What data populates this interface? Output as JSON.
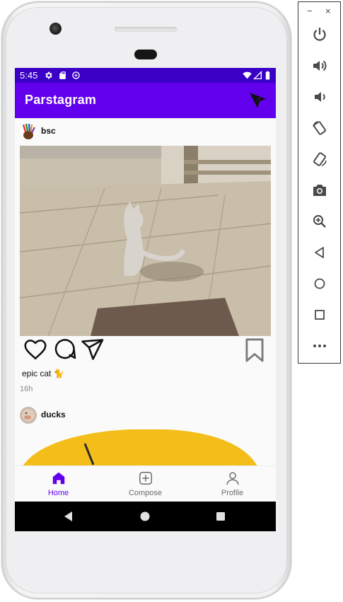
{
  "status_bar": {
    "time": "5:45",
    "left_icons": [
      "gear-icon",
      "sd-card-icon",
      "data-saver-icon"
    ],
    "right_icons": [
      "wifi-icon",
      "signal-icon",
      "battery-icon"
    ]
  },
  "app_bar": {
    "title": "Parstagram",
    "action_icon": "send-icon"
  },
  "posts": [
    {
      "username": "bsc",
      "caption": "epic cat 🐈",
      "time_ago": "16h",
      "actions": [
        "heart-icon",
        "comment-icon",
        "share-icon",
        "bookmark-icon"
      ]
    },
    {
      "username": "ducks"
    }
  ],
  "bottom_nav": {
    "items": [
      {
        "label": "Home",
        "icon": "home-icon",
        "active": true
      },
      {
        "label": "Compose",
        "icon": "add-box-icon",
        "active": false
      },
      {
        "label": "Profile",
        "icon": "person-icon",
        "active": false
      }
    ]
  },
  "emulator_toolbar": {
    "window_buttons": [
      "−",
      "×"
    ],
    "buttons": [
      "power-icon",
      "volume-up-icon",
      "volume-down-icon",
      "rotate-left-icon",
      "rotate-right-icon",
      "camera-icon",
      "zoom-icon",
      "back-icon",
      "home-icon",
      "overview-icon",
      "more-icon"
    ]
  },
  "colors": {
    "primary": "#6200ee",
    "primary_dark": "#3a00c6",
    "nav_inactive": "#6b6b6b"
  }
}
